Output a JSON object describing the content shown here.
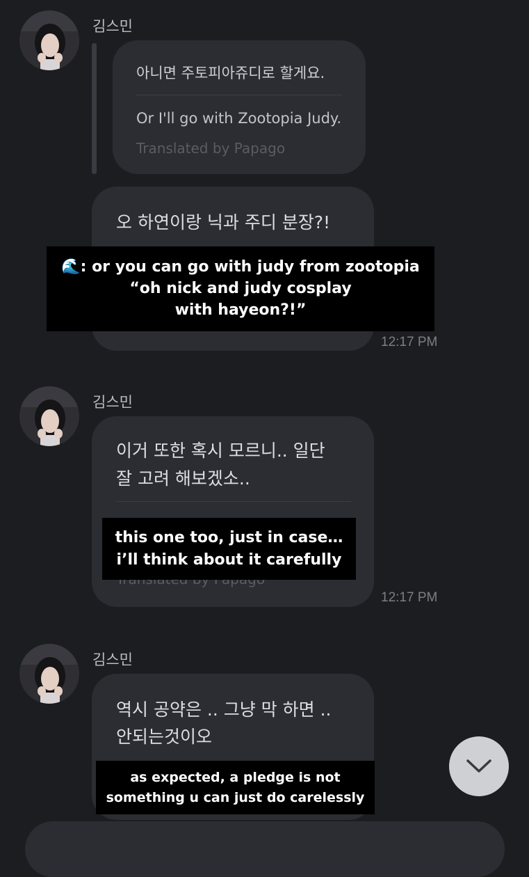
{
  "messages": [
    {
      "sender": "김스민",
      "original": "아니면 주토피아쥬디로 할게요.",
      "translation": "Or I'll go with Zootopia Judy.",
      "credit": "Translated by Papago"
    },
    {
      "original": "오 하연이랑 닉과 주디 분장?!",
      "time": "12:17 PM"
    },
    {
      "sender": "김스민",
      "original_line1": "이거 또한 혹시 모르니.. 일단",
      "original_line2": "잘 고려 해보겠소..",
      "credit": "Translated by Papago",
      "time": "12:17 PM"
    },
    {
      "sender": "김스민",
      "original_line1": "역시 공약은 .. 그냥 막 하면 ..",
      "original_line2": "안되는것이오"
    }
  ],
  "captions": [
    {
      "line1": "🌊: or you can go with judy from zootopia",
      "line2": "“oh nick and judy cosplay",
      "line3": "with hayeon?!”"
    },
    {
      "line1": "this one too, just in case…",
      "line2": "i’ll think about it carefully"
    },
    {
      "line1": "as expected, a pledge is not",
      "line2": "something u can just do carelessly"
    }
  ],
  "scroll_button": {
    "icon": "chevron-down-icon"
  }
}
